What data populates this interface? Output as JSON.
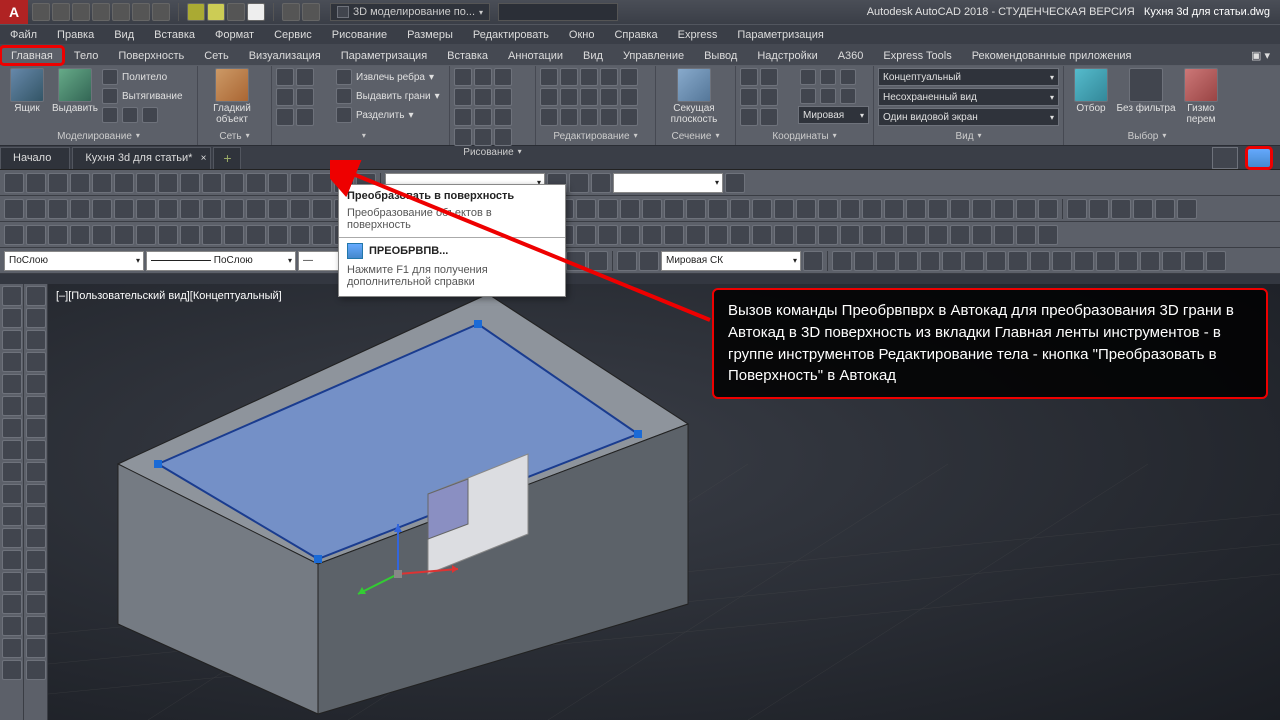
{
  "title": {
    "app": "Autodesk AutoCAD 2018 - СТУДЕНЧЕСКАЯ ВЕРСИЯ",
    "file": "Кухня 3d для статьи.dwg"
  },
  "workspace": "3D моделирование по...",
  "menus": [
    "Файл",
    "Правка",
    "Вид",
    "Вставка",
    "Формат",
    "Сервис",
    "Рисование",
    "Размеры",
    "Редактировать",
    "Окно",
    "Справка",
    "Express",
    "Параметризация"
  ],
  "ribbon_tabs": [
    "Главная",
    "Тело",
    "Поверхность",
    "Сеть",
    "Визуализация",
    "Параметризация",
    "Вставка",
    "Аннотации",
    "Вид",
    "Управление",
    "Вывод",
    "Надстройки",
    "A360",
    "Express Tools",
    "Рекомендованные приложения"
  ],
  "panels": {
    "modeling": {
      "title": "Моделирование",
      "big": [
        "Ящик",
        "Выдавить"
      ],
      "btns": [
        "Политело",
        "Вытягивание"
      ]
    },
    "mesh": {
      "title": "Сеть",
      "big": "Гладкий объект"
    },
    "solid_edit": {
      "btns": [
        "Извлечь ребра",
        "Выдавить грани",
        "Разделить"
      ]
    },
    "draw": {
      "title": "Рисование"
    },
    "modify": {
      "title": "Редактирование"
    },
    "section": {
      "title": "Сечение",
      "big": "Секущая плоскость"
    },
    "coords": {
      "title": "Координаты",
      "combo": "Мировая"
    },
    "view": {
      "title": "Вид",
      "c1": "Концептуальный",
      "c2": "Несохраненный вид",
      "c3": "Один видовой экран"
    },
    "select": {
      "title": "Выбор",
      "big1": "Отбор",
      "big2": "Без фильтра",
      "big3": "Гизмо перем"
    }
  },
  "doc_tabs": {
    "start": "Начало",
    "file": "Кухня 3d для статьи*"
  },
  "layer_combo": "ПоСлою",
  "layer_combo2": "ПоСлою",
  "ucs_combo": "Мировая СК",
  "view_label": "[–][Пользовательский вид][Концептуальный]",
  "tooltip": {
    "title": "Преобразовать в поверхность",
    "desc": "Преобразование объектов в поверхность",
    "cmd": "ПРЕОБРВПВ...",
    "hint": "Нажмите F1 для получения дополнительной справки"
  },
  "callout": "Вызов команды Преобрвпврх в Автокад для преобразования 3D грани в Автокад в 3D поверхность из вкладки Главная ленты инструментов - в группе инструментов Редактирование тела - кнопка \"Преобразовать в Поверхность\" в Автокад"
}
